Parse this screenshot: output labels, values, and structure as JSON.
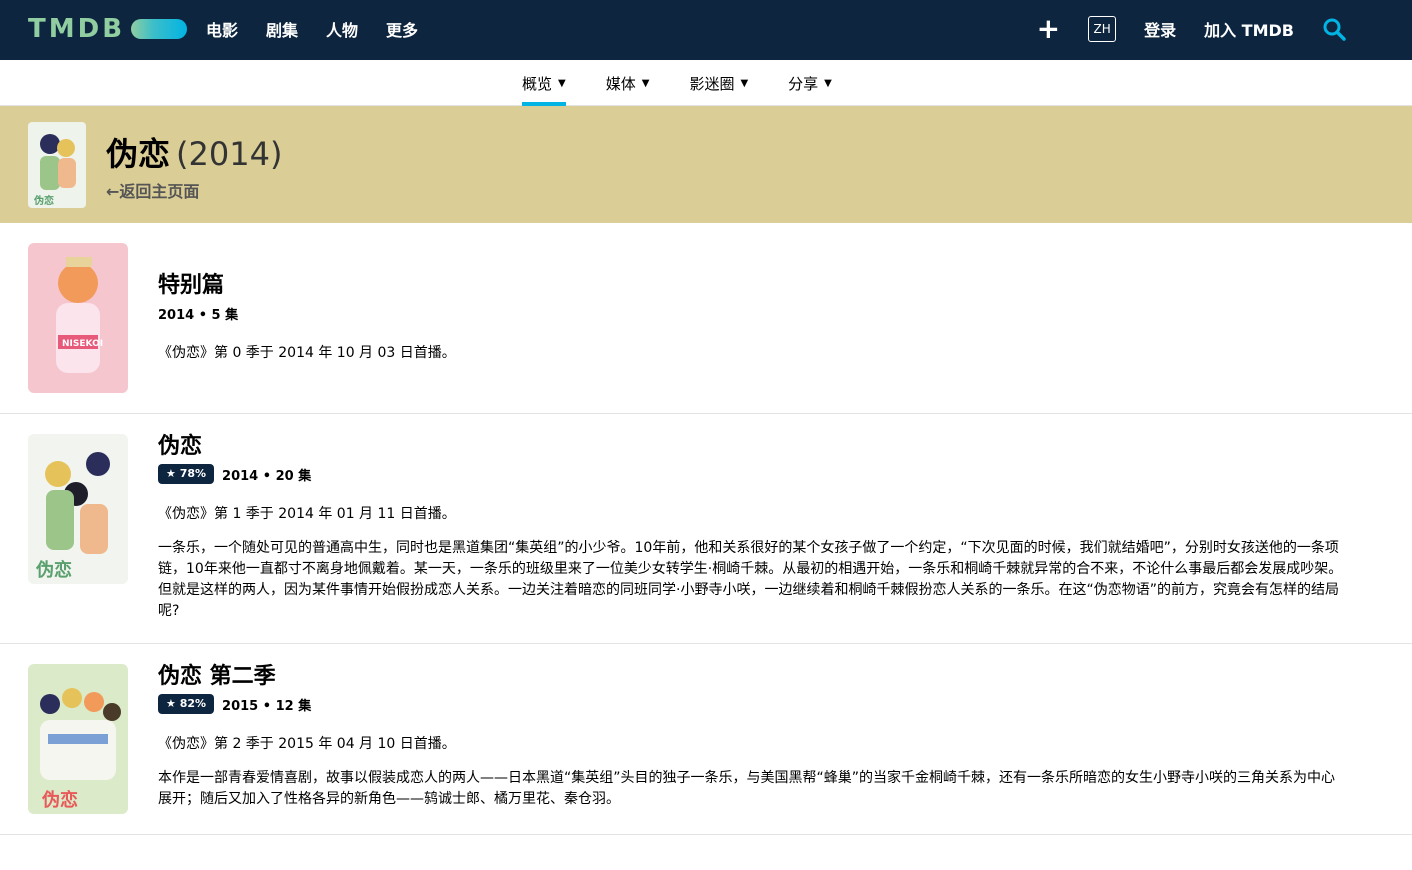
{
  "header": {
    "logo_text": "TMDB",
    "nav": [
      "电影",
      "剧集",
      "人物",
      "更多"
    ],
    "plus_icon": "plus-icon",
    "language": "ZH",
    "login": "登录",
    "join": "加入 TMDB",
    "search_icon": "search-icon"
  },
  "subnav": [
    {
      "label": "概览",
      "active": true
    },
    {
      "label": "媒体",
      "active": false
    },
    {
      "label": "影迷圈",
      "active": false
    },
    {
      "label": "分享",
      "active": false
    }
  ],
  "show": {
    "title": "伪恋",
    "year": "(2014)",
    "back_link": "返回主页面"
  },
  "seasons": [
    {
      "title": "特别篇",
      "rating": null,
      "meta": "2014 • 5 集",
      "air": "《伪恋》第 0 季于 2014 年 10 月 03 日首播。",
      "overview": ""
    },
    {
      "title": "伪恋",
      "rating": "★ 78%",
      "meta": "2014 • 20 集",
      "air": "《伪恋》第 1 季于 2014 年 01 月 11 日首播。",
      "overview": "一条乐，一个随处可见的普通高中生，同时也是黑道集团“集英组”的小少爷。10年前，他和关系很好的某个女孩子做了一个约定，“下次见面的时候，我们就结婚吧”，分别时女孩送他的一条项链，10年来他一直都寸不离身地佩戴着。某一天，一条乐的班级里来了一位美少女转学生·桐崎千棘。从最初的相遇开始，一条乐和桐崎千棘就异常的合不来，不论什么事最后都会发展成吵架。但就是这样的两人，因为某件事情开始假扮成恋人关系。一边关注着暗恋的同班同学·小野寺小咲，一边继续着和桐崎千棘假扮恋人关系的一条乐。在这“伪恋物语”的前方，究竟会有怎样的结局呢?"
    },
    {
      "title": "伪恋 第二季",
      "rating": "★ 82%",
      "meta": "2015 • 12 集",
      "air": "《伪恋》第 2 季于 2015 年 04 月 10 日首播。",
      "overview": "本作是一部青春爱情喜剧，故事以假装成恋人的两人——日本黑道“集英组”头目的独子一条乐，与美国黑帮“蜂巢”的当家千金桐崎千棘，还有一条乐所暗恋的女生小野寺小咲的三角关系为中心展开；随后又加入了性格各异的新角色——鸫诚士郎、橘万里花、秦仓羽。"
    }
  ],
  "colors": {
    "topbar": "#0d253f",
    "band": "#dacd96",
    "accent": "#01b4e4"
  }
}
